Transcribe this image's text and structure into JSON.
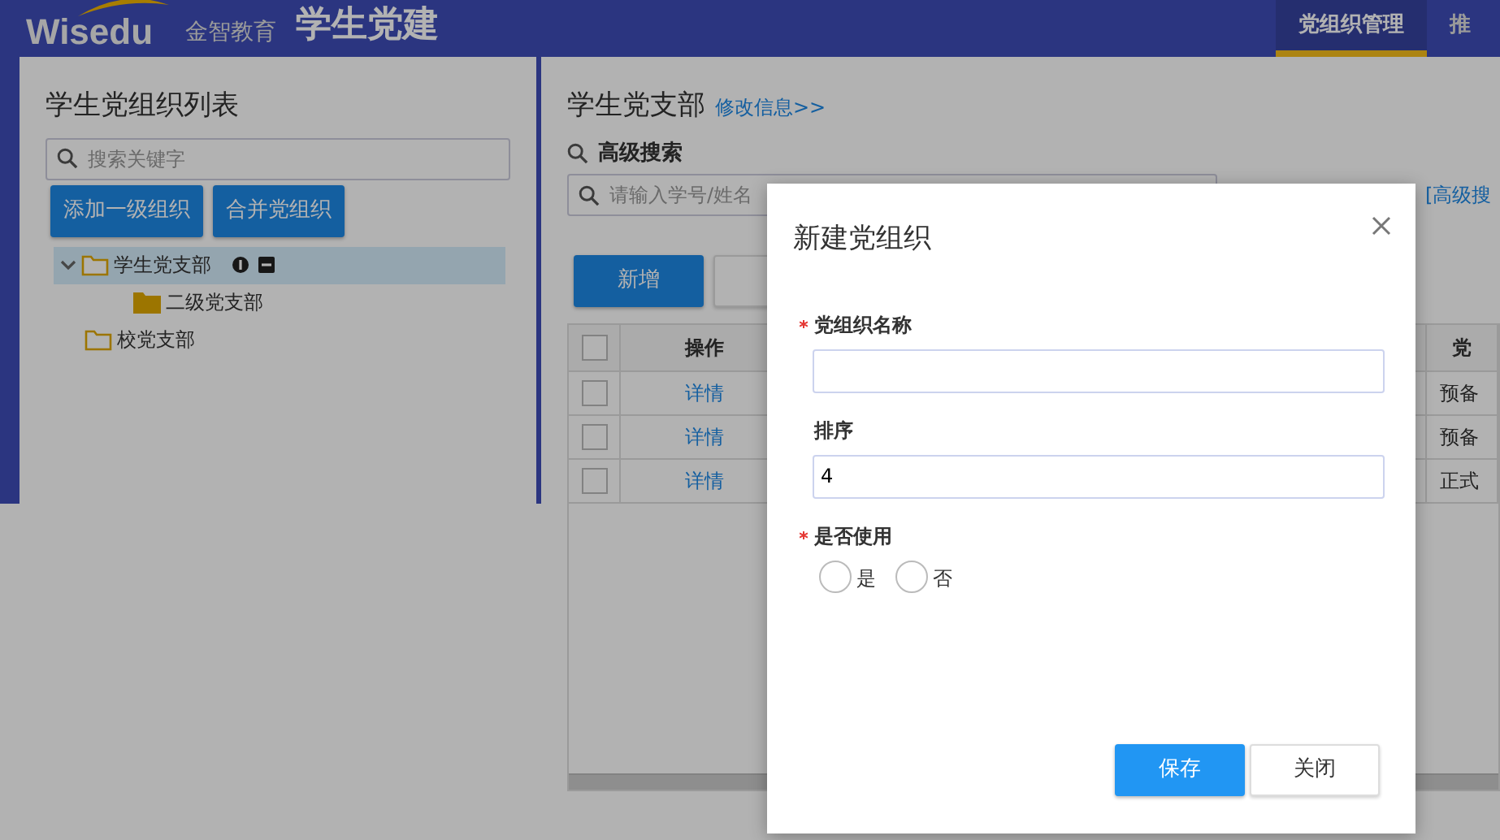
{
  "header": {
    "logo_text": "Wisedu",
    "logo_sub": "金智教育",
    "app_title": "学生党建",
    "nav": [
      {
        "label": "党组织管理",
        "selected": true
      },
      {
        "label": "推",
        "selected": false
      }
    ]
  },
  "sidebar": {
    "title": "学生党组织列表",
    "search": {
      "placeholder": "搜索关键字"
    },
    "buttons": [
      "添加一级组织",
      "合并党组织"
    ],
    "tree": [
      {
        "label": "学生党支部",
        "expanded": true,
        "selected": true,
        "children": [
          {
            "label": "二级党支部",
            "selected": false
          }
        ]
      },
      {
        "label": "校党支部",
        "selected": false
      }
    ]
  },
  "main": {
    "title": "学生党支部",
    "edit_link": "修改信息>>",
    "advanced_search": "高级搜索",
    "search": {
      "placeholder": "请输入学号/姓名"
    },
    "advanced_link": "[高级搜",
    "toolbar": [
      {
        "label": "新增",
        "primary": true
      },
      {
        "primary": false
      }
    ],
    "table": {
      "all_checked": false,
      "columns": [
        "操作",
        "党"
      ],
      "rows": [
        {
          "checked": false,
          "action": "详情",
          "column_2": "预备"
        },
        {
          "checked": false,
          "action": "详情",
          "column_2": "预备"
        },
        {
          "checked": false,
          "action": "详情",
          "column_2": "正式"
        }
      ]
    }
  },
  "modal": {
    "title": "新建党组织",
    "fields": [
      {
        "kind": "text",
        "label": "党组织名称",
        "required": true
      },
      {
        "kind": "text",
        "label": "排序",
        "required": false,
        "value": "4"
      },
      {
        "kind": "radio",
        "label": "是否使用",
        "required": true,
        "options": [
          {
            "label": "是",
            "selected": false
          },
          {
            "label": "否",
            "selected": false
          }
        ]
      }
    ],
    "buttons": [
      {
        "label": "保存",
        "primary": true
      },
      {
        "label": "关闭",
        "primary": false
      }
    ]
  }
}
